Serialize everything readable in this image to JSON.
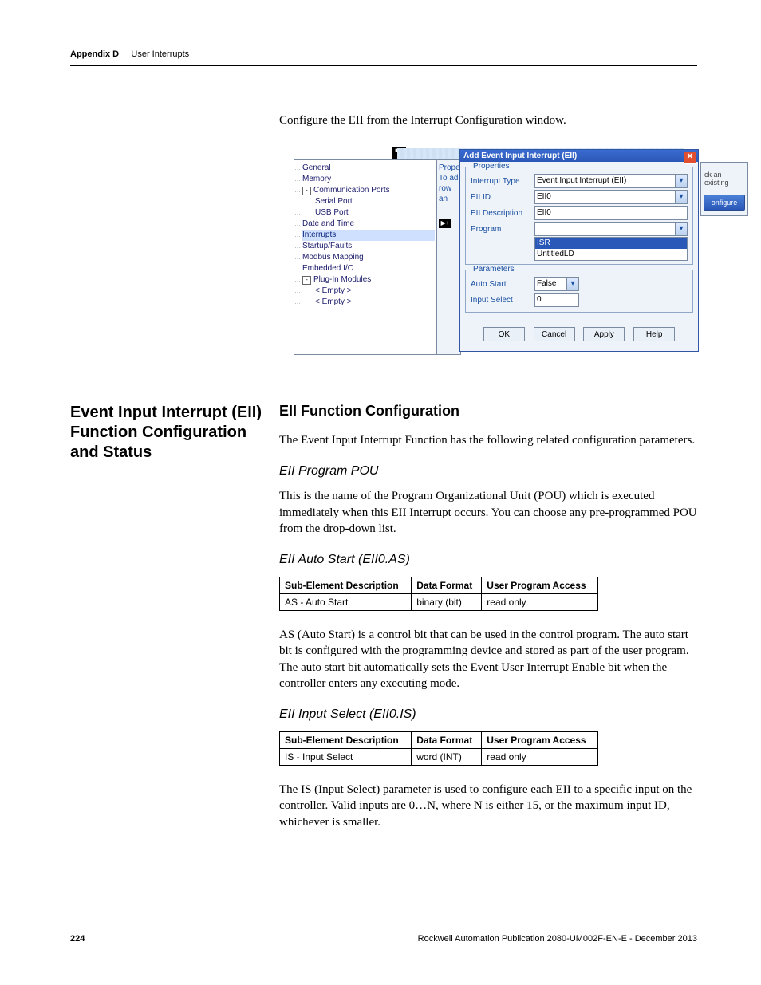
{
  "header": {
    "appendix": "Appendix D",
    "title": "User Interrupts"
  },
  "intro": "Configure the EII from the Interrupt Configuration window.",
  "screenshot": {
    "tree": {
      "items": [
        "General",
        "Memory",
        "Communication Ports",
        "Serial Port",
        "USB Port",
        "Date and Time",
        "Interrupts",
        "Startup/Faults",
        "Modbus Mapping",
        "Embedded I/O",
        "Plug-In Modules",
        "< Empty >",
        "< Empty >"
      ],
      "selected": "Interrupts"
    },
    "propstrip": {
      "l0": "Properti",
      "l1": "To ad",
      "l2": "row an",
      "arrow": "▶+"
    },
    "dialog": {
      "title": "Add Event Input Interrupt (EII)",
      "close": "✕",
      "group_props": "Properties",
      "group_params": "Parameters",
      "fields": {
        "interrupt_type": {
          "label": "Interrupt Type",
          "value": "Event Input Interrupt (EII)"
        },
        "eii_id": {
          "label": "EII ID",
          "value": "EII0"
        },
        "eii_desc": {
          "label": "EII Description",
          "value": "EII0"
        },
        "program": {
          "label": "Program",
          "value": "",
          "options": [
            "ISR",
            "UntitledLD"
          ],
          "hi": "ISR"
        },
        "auto_start": {
          "label": "Auto Start",
          "value": "False"
        },
        "input_select": {
          "label": "Input Select",
          "value": "0"
        }
      },
      "buttons": {
        "ok": "OK",
        "cancel": "Cancel",
        "apply": "Apply",
        "help": "Help"
      }
    },
    "side": {
      "label": "ck an existing",
      "button": "onfigure"
    }
  },
  "section": {
    "left_heading": "Event Input Interrupt (EII) Function Configuration and Status",
    "h2": "EII Function Configuration",
    "p1": "The Event Input Interrupt Function has the following related configuration parameters.",
    "pou_h": "EII Program POU",
    "pou_p": "This is the name of the Program Organizational Unit (POU) which is executed immediately when this EII Interrupt occurs. You can choose any pre-programmed POU from the drop-down list.",
    "as_h": "EII Auto Start (EII0.AS)",
    "as_tbl": {
      "h1": "Sub-Element Description",
      "h2": "Data Format",
      "h3": "User Program Access",
      "r1c1": "AS - Auto Start",
      "r1c2": "binary (bit)",
      "r1c3": "read only"
    },
    "as_p": "AS (Auto Start) is a control bit that can be used in the control program. The auto start bit is configured with the programming device and stored as part of the user program. The auto start bit automatically sets the Event User Interrupt Enable bit when the controller enters any executing mode.",
    "is_h": "EII Input Select (EII0.IS)",
    "is_tbl": {
      "h1": "Sub-Element Description",
      "h2": "Data Format",
      "h3": "User Program Access",
      "r1c1": "IS - Input Select",
      "r1c2": "word (INT)",
      "r1c3": "read only"
    },
    "is_p": "The IS (Input Select) parameter is used to configure each EII to a specific input on the controller. Valid inputs are 0…N, where N is either 15, or the maximum input ID, whichever is smaller."
  },
  "footer": {
    "page": "224",
    "pub": "Rockwell Automation Publication 2080-UM002F-EN-E - December 2013"
  }
}
